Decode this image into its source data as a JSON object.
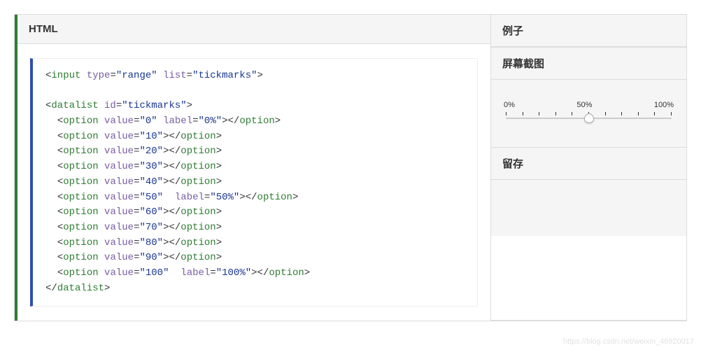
{
  "left": {
    "header": "HTML",
    "code_lines": [
      [
        {
          "t": "punct",
          "v": "<"
        },
        {
          "t": "tag",
          "v": "input"
        },
        {
          "t": "plain",
          "v": " "
        },
        {
          "t": "attr",
          "v": "type"
        },
        {
          "t": "punct",
          "v": "="
        },
        {
          "t": "str",
          "v": "\"range\""
        },
        {
          "t": "plain",
          "v": " "
        },
        {
          "t": "attr",
          "v": "list"
        },
        {
          "t": "punct",
          "v": "="
        },
        {
          "t": "str",
          "v": "\"tickmarks\""
        },
        {
          "t": "punct",
          "v": ">"
        }
      ],
      [],
      [
        {
          "t": "punct",
          "v": "<"
        },
        {
          "t": "tag",
          "v": "datalist"
        },
        {
          "t": "plain",
          "v": " "
        },
        {
          "t": "attr",
          "v": "id"
        },
        {
          "t": "punct",
          "v": "="
        },
        {
          "t": "str",
          "v": "\"tickmarks\""
        },
        {
          "t": "punct",
          "v": ">"
        }
      ],
      [
        {
          "t": "plain",
          "v": "  "
        },
        {
          "t": "punct",
          "v": "<"
        },
        {
          "t": "tag",
          "v": "option"
        },
        {
          "t": "plain",
          "v": " "
        },
        {
          "t": "attr",
          "v": "value"
        },
        {
          "t": "punct",
          "v": "="
        },
        {
          "t": "str",
          "v": "\"0\""
        },
        {
          "t": "plain",
          "v": " "
        },
        {
          "t": "attr",
          "v": "label"
        },
        {
          "t": "punct",
          "v": "="
        },
        {
          "t": "str",
          "v": "\"0%\""
        },
        {
          "t": "punct",
          "v": ">"
        },
        {
          "t": "punct",
          "v": "</"
        },
        {
          "t": "tag",
          "v": "option"
        },
        {
          "t": "punct",
          "v": ">"
        }
      ],
      [
        {
          "t": "plain",
          "v": "  "
        },
        {
          "t": "punct",
          "v": "<"
        },
        {
          "t": "tag",
          "v": "option"
        },
        {
          "t": "plain",
          "v": " "
        },
        {
          "t": "attr",
          "v": "value"
        },
        {
          "t": "punct",
          "v": "="
        },
        {
          "t": "str",
          "v": "\"10\""
        },
        {
          "t": "punct",
          "v": ">"
        },
        {
          "t": "punct",
          "v": "</"
        },
        {
          "t": "tag",
          "v": "option"
        },
        {
          "t": "punct",
          "v": ">"
        }
      ],
      [
        {
          "t": "plain",
          "v": "  "
        },
        {
          "t": "punct",
          "v": "<"
        },
        {
          "t": "tag",
          "v": "option"
        },
        {
          "t": "plain",
          "v": " "
        },
        {
          "t": "attr",
          "v": "value"
        },
        {
          "t": "punct",
          "v": "="
        },
        {
          "t": "str",
          "v": "\"20\""
        },
        {
          "t": "punct",
          "v": ">"
        },
        {
          "t": "punct",
          "v": "</"
        },
        {
          "t": "tag",
          "v": "option"
        },
        {
          "t": "punct",
          "v": ">"
        }
      ],
      [
        {
          "t": "plain",
          "v": "  "
        },
        {
          "t": "punct",
          "v": "<"
        },
        {
          "t": "tag",
          "v": "option"
        },
        {
          "t": "plain",
          "v": " "
        },
        {
          "t": "attr",
          "v": "value"
        },
        {
          "t": "punct",
          "v": "="
        },
        {
          "t": "str",
          "v": "\"30\""
        },
        {
          "t": "punct",
          "v": ">"
        },
        {
          "t": "punct",
          "v": "</"
        },
        {
          "t": "tag",
          "v": "option"
        },
        {
          "t": "punct",
          "v": ">"
        }
      ],
      [
        {
          "t": "plain",
          "v": "  "
        },
        {
          "t": "punct",
          "v": "<"
        },
        {
          "t": "tag",
          "v": "option"
        },
        {
          "t": "plain",
          "v": " "
        },
        {
          "t": "attr",
          "v": "value"
        },
        {
          "t": "punct",
          "v": "="
        },
        {
          "t": "str",
          "v": "\"40\""
        },
        {
          "t": "punct",
          "v": ">"
        },
        {
          "t": "punct",
          "v": "</"
        },
        {
          "t": "tag",
          "v": "option"
        },
        {
          "t": "punct",
          "v": ">"
        }
      ],
      [
        {
          "t": "plain",
          "v": "  "
        },
        {
          "t": "punct",
          "v": "<"
        },
        {
          "t": "tag",
          "v": "option"
        },
        {
          "t": "plain",
          "v": " "
        },
        {
          "t": "attr",
          "v": "value"
        },
        {
          "t": "punct",
          "v": "="
        },
        {
          "t": "str",
          "v": "\"50\""
        },
        {
          "t": "plain",
          "v": "  "
        },
        {
          "t": "attr",
          "v": "label"
        },
        {
          "t": "punct",
          "v": "="
        },
        {
          "t": "str",
          "v": "\"50%\""
        },
        {
          "t": "punct",
          "v": ">"
        },
        {
          "t": "punct",
          "v": "</"
        },
        {
          "t": "tag",
          "v": "option"
        },
        {
          "t": "punct",
          "v": ">"
        }
      ],
      [
        {
          "t": "plain",
          "v": "  "
        },
        {
          "t": "punct",
          "v": "<"
        },
        {
          "t": "tag",
          "v": "option"
        },
        {
          "t": "plain",
          "v": " "
        },
        {
          "t": "attr",
          "v": "value"
        },
        {
          "t": "punct",
          "v": "="
        },
        {
          "t": "str",
          "v": "\"60\""
        },
        {
          "t": "punct",
          "v": ">"
        },
        {
          "t": "punct",
          "v": "</"
        },
        {
          "t": "tag",
          "v": "option"
        },
        {
          "t": "punct",
          "v": ">"
        }
      ],
      [
        {
          "t": "plain",
          "v": "  "
        },
        {
          "t": "punct",
          "v": "<"
        },
        {
          "t": "tag",
          "v": "option"
        },
        {
          "t": "plain",
          "v": " "
        },
        {
          "t": "attr",
          "v": "value"
        },
        {
          "t": "punct",
          "v": "="
        },
        {
          "t": "str",
          "v": "\"70\""
        },
        {
          "t": "punct",
          "v": ">"
        },
        {
          "t": "punct",
          "v": "</"
        },
        {
          "t": "tag",
          "v": "option"
        },
        {
          "t": "punct",
          "v": ">"
        }
      ],
      [
        {
          "t": "plain",
          "v": "  "
        },
        {
          "t": "punct",
          "v": "<"
        },
        {
          "t": "tag",
          "v": "option"
        },
        {
          "t": "plain",
          "v": " "
        },
        {
          "t": "attr",
          "v": "value"
        },
        {
          "t": "punct",
          "v": "="
        },
        {
          "t": "str",
          "v": "\"80\""
        },
        {
          "t": "punct",
          "v": ">"
        },
        {
          "t": "punct",
          "v": "</"
        },
        {
          "t": "tag",
          "v": "option"
        },
        {
          "t": "punct",
          "v": ">"
        }
      ],
      [
        {
          "t": "plain",
          "v": "  "
        },
        {
          "t": "punct",
          "v": "<"
        },
        {
          "t": "tag",
          "v": "option"
        },
        {
          "t": "plain",
          "v": " "
        },
        {
          "t": "attr",
          "v": "value"
        },
        {
          "t": "punct",
          "v": "="
        },
        {
          "t": "str",
          "v": "\"90\""
        },
        {
          "t": "punct",
          "v": ">"
        },
        {
          "t": "punct",
          "v": "</"
        },
        {
          "t": "tag",
          "v": "option"
        },
        {
          "t": "punct",
          "v": ">"
        }
      ],
      [
        {
          "t": "plain",
          "v": "  "
        },
        {
          "t": "punct",
          "v": "<"
        },
        {
          "t": "tag",
          "v": "option"
        },
        {
          "t": "plain",
          "v": " "
        },
        {
          "t": "attr",
          "v": "value"
        },
        {
          "t": "punct",
          "v": "="
        },
        {
          "t": "str",
          "v": "\"100\""
        },
        {
          "t": "plain",
          "v": "  "
        },
        {
          "t": "attr",
          "v": "label"
        },
        {
          "t": "punct",
          "v": "="
        },
        {
          "t": "str",
          "v": "\"100%\""
        },
        {
          "t": "punct",
          "v": ">"
        },
        {
          "t": "punct",
          "v": "</"
        },
        {
          "t": "tag",
          "v": "option"
        },
        {
          "t": "punct",
          "v": ">"
        }
      ],
      [
        {
          "t": "punct",
          "v": "</"
        },
        {
          "t": "tag",
          "v": "datalist"
        },
        {
          "t": "punct",
          "v": ">"
        }
      ]
    ]
  },
  "right": {
    "sections": {
      "example_header": "例子",
      "screenshot_header": "屏幕截图",
      "persist_header": "留存"
    },
    "slider": {
      "labels": [
        "0%",
        "50%",
        "100%"
      ],
      "value": 50,
      "min": 0,
      "max": 100,
      "tick_count": 11
    }
  },
  "watermark": "https://blog.csdn.net/weixin_46920017"
}
